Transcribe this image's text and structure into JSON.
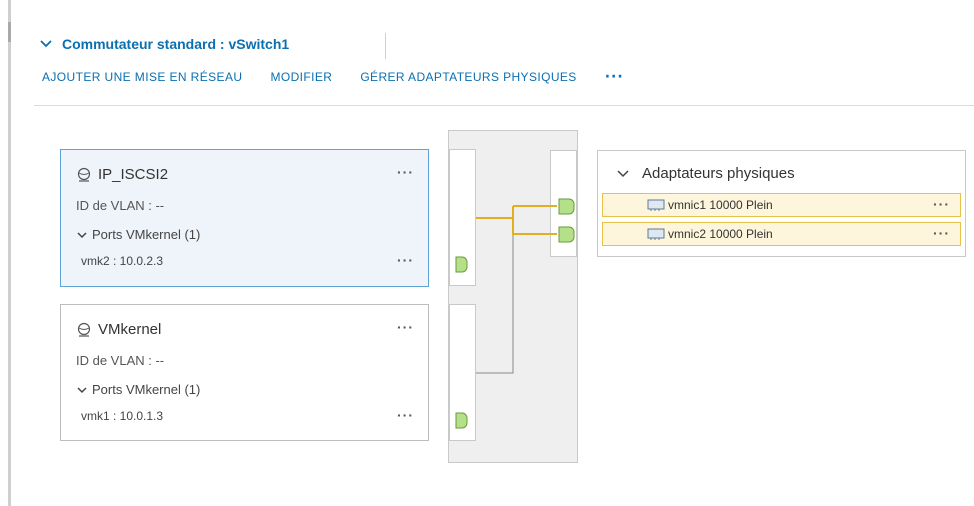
{
  "section": {
    "title": "Commutateur standard : vSwitch1"
  },
  "toolbar": {
    "add_networking": "AJOUTER UNE MISE EN RÉSEAU",
    "edit": "MODIFIER",
    "manage_physical": "GÉRER ADAPTATEURS PHYSIQUES",
    "more": "···"
  },
  "port_groups": [
    {
      "name": "IP_ISCSI2",
      "vlan": "ID de VLAN : --",
      "ports_label": "Ports VMkernel (1)",
      "port": "vmk2 : 10.0.2.3",
      "more": "···",
      "port_more": "···",
      "selected": true
    },
    {
      "name": "VMkernel",
      "vlan": "ID de VLAN : --",
      "ports_label": "Ports VMkernel (1)",
      "port": "vmk1 : 10.0.1.3",
      "more": "···",
      "port_more": "···",
      "selected": false
    }
  ],
  "adapters": {
    "title": "Adaptateurs physiques",
    "items": [
      {
        "label": "vmnic1 10000 Plein",
        "more": "···"
      },
      {
        "label": "vmnic2 10000 Plein",
        "more": "···"
      }
    ]
  },
  "colors": {
    "link": "#0b6fb0",
    "selected_bg": "#eef4fa",
    "selected_border": "#5ea3d6",
    "active_wire": "#e0b020",
    "idle_wire": "#8a8a8a",
    "port_green": "#b5e08a"
  },
  "icons": {
    "collapse": "chevron-down-icon",
    "portgroup": "network-globe-icon",
    "nic": "nic-card-icon"
  }
}
